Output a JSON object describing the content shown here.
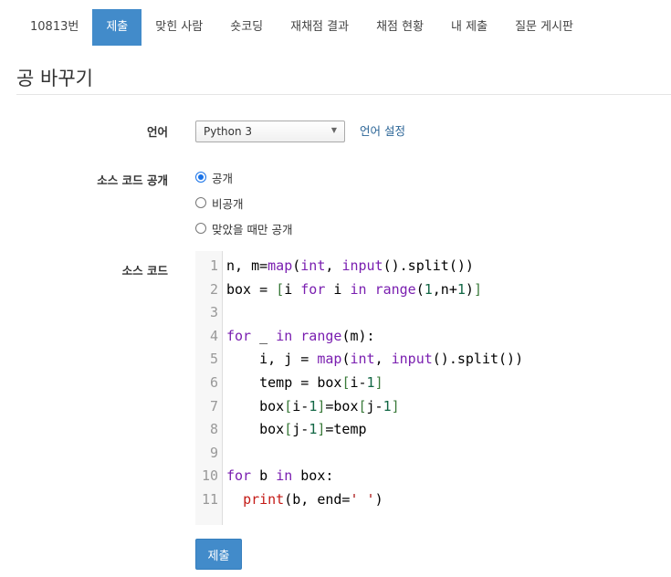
{
  "tabs": [
    {
      "label": "10813번"
    },
    {
      "label": "제출"
    },
    {
      "label": "맞힌 사람"
    },
    {
      "label": "숏코딩"
    },
    {
      "label": "재채점 결과"
    },
    {
      "label": "채점 현황"
    },
    {
      "label": "내 제출"
    },
    {
      "label": "질문 게시판"
    }
  ],
  "active_tab_index": 1,
  "page_title": "공 바꾸기",
  "form": {
    "language_label": "언어",
    "language_value": "Python 3",
    "language_settings_link": "언어 설정",
    "visibility_label": "소스 코드 공개",
    "visibility_options": [
      "공개",
      "비공개",
      "맞았을 때만 공개"
    ],
    "visibility_selected": "공개",
    "source_label": "소스 코드",
    "submit_label": "제출"
  },
  "code_lines": [
    "n, m=map(int, input().split())",
    "box = [i for i in range(1,n+1)]",
    "",
    "for _ in range(m):",
    "    i, j = map(int, input().split())",
    "    temp = box[i-1]",
    "    box[i-1]=box[j-1]",
    "    box[j-1]=temp",
    "",
    "for b in box:",
    "  print(b, end=' ')"
  ],
  "line_numbers": [
    "1",
    "2",
    "3",
    "4",
    "5",
    "6",
    "7",
    "8",
    "9",
    "10",
    "11"
  ],
  "colors": {
    "accent": "#428bca",
    "link": "#2a6496",
    "keyword": "#7a1fb0",
    "number": "#116644",
    "string": "#aa1111"
  }
}
